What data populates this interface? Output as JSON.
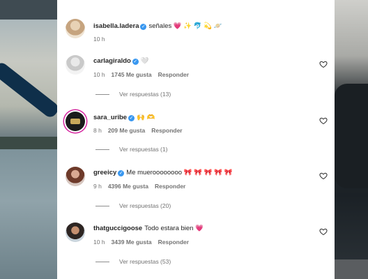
{
  "comments": [
    {
      "username": "isabella.ladera",
      "text": "señales 💗 ✨ 🐬 💫 🪐",
      "time": "10 h",
      "likes": "",
      "reply_label": "",
      "view_replies": ""
    },
    {
      "username": "carlagiraldo",
      "text": "🤍",
      "time": "10 h",
      "likes": "1745 Me gusta",
      "reply_label": "Responder",
      "view_replies": "Ver respuestas (13)"
    },
    {
      "username": "sara_uribe",
      "text": "🙌 🫶",
      "time": "8 h",
      "likes": "209 Me gusta",
      "reply_label": "Responder",
      "view_replies": "Ver respuestas (1)"
    },
    {
      "username": "greeicy",
      "text": "Me mueroooooooo 🎀 🎀 🎀 🎀 🎀",
      "time": "9 h",
      "likes": "4396 Me gusta",
      "reply_label": "Responder",
      "view_replies": "Ver respuestas (20)"
    },
    {
      "username": "thatguccigoose",
      "text": "Todo estara bien 💗",
      "time": "10 h",
      "likes": "3439 Me gusta",
      "reply_label": "Responder",
      "view_replies": "Ver respuestas (53)"
    }
  ],
  "icons": {
    "verified": "verified-badge-icon",
    "like": "heart-outline-icon"
  },
  "colors": {
    "verified_blue": "#3897f0",
    "text_primary": "#262626",
    "text_secondary": "#737373",
    "story_ring": "#d6249f"
  }
}
